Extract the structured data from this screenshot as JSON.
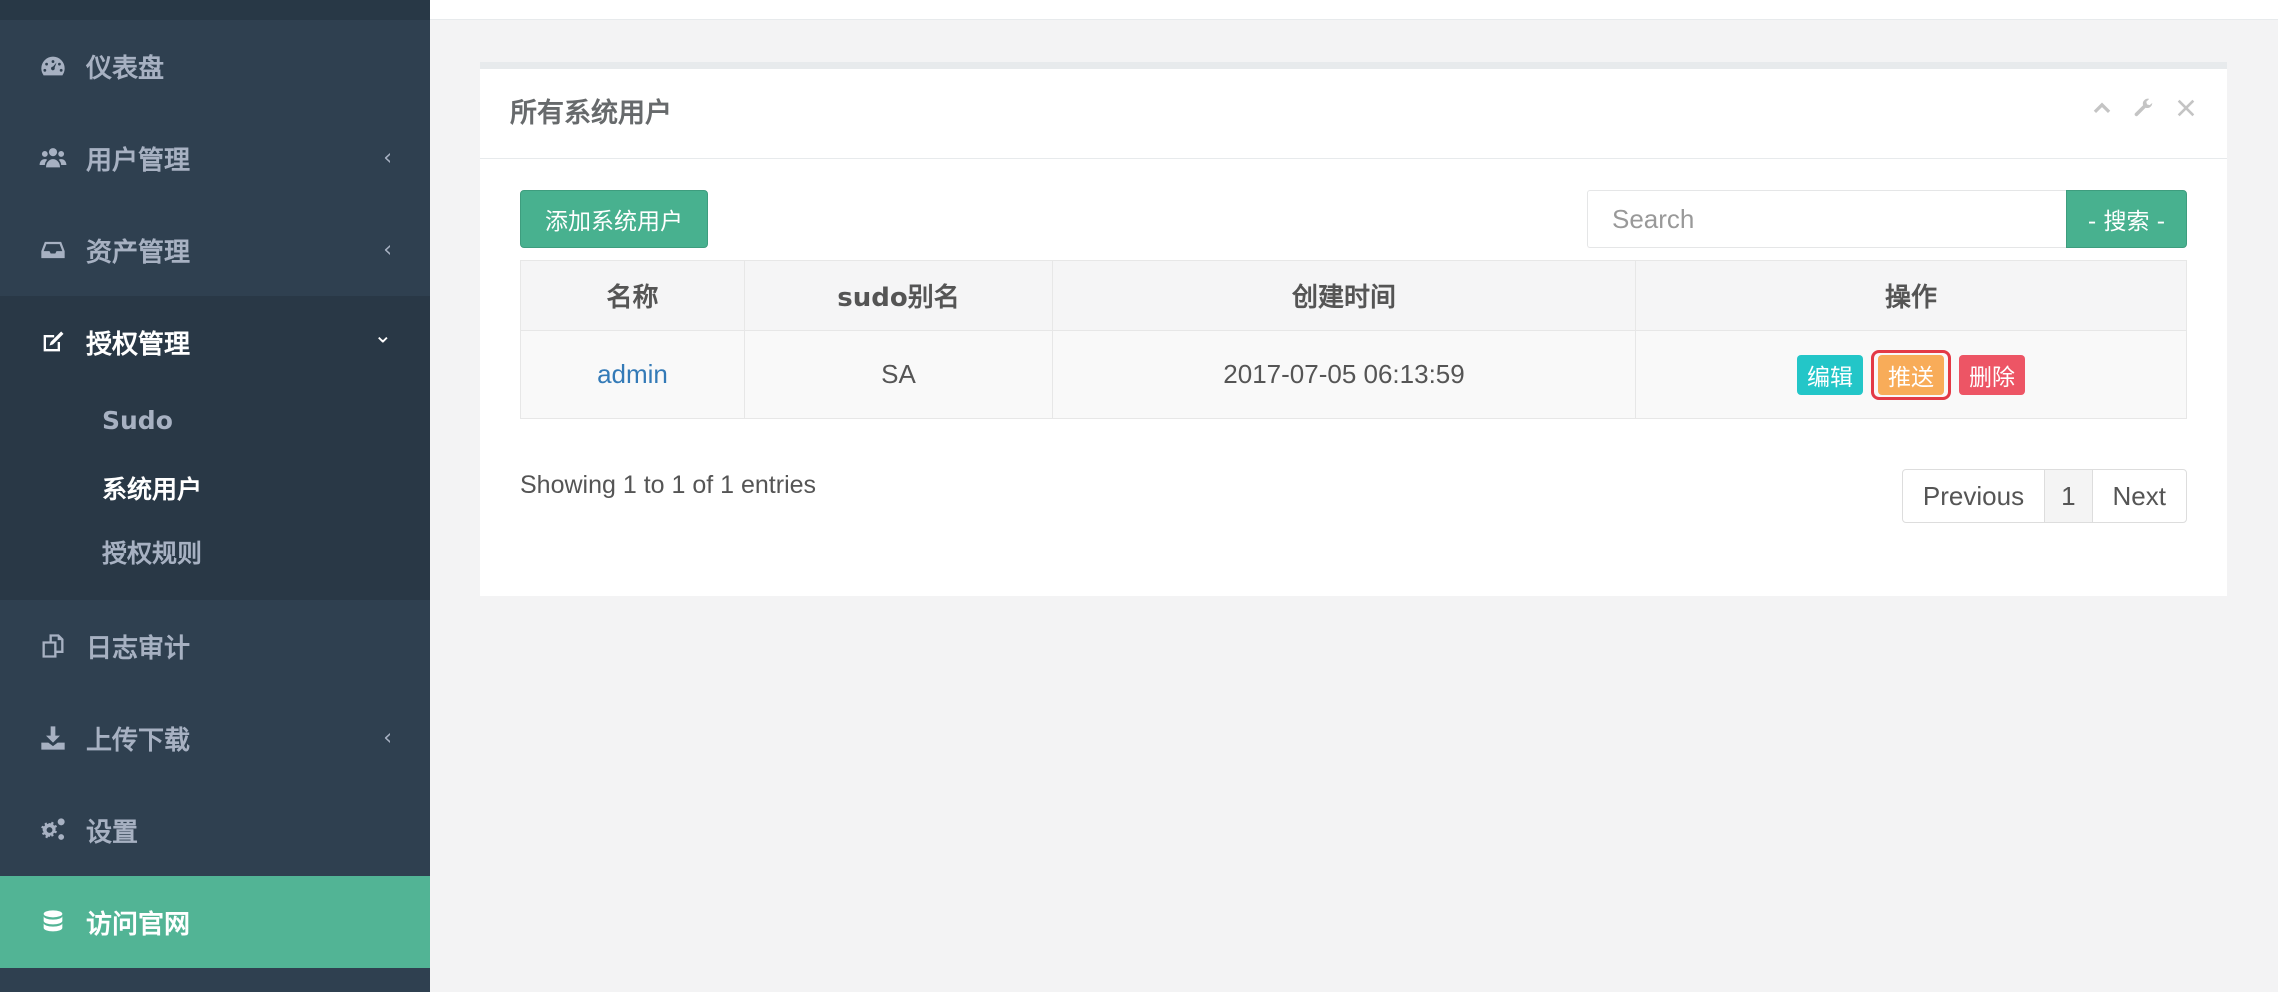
{
  "sidebar": {
    "items": [
      {
        "label": "仪表盘",
        "icon": "dashboard-icon"
      },
      {
        "label": "用户管理",
        "icon": "users-icon",
        "arrow": "‹"
      },
      {
        "label": "资产管理",
        "icon": "inbox-icon",
        "arrow": "‹"
      },
      {
        "label": "授权管理",
        "icon": "edit-icon",
        "arrow": "⌄"
      },
      {
        "label": "日志审计",
        "icon": "copy-icon"
      },
      {
        "label": "上传下载",
        "icon": "download-icon",
        "arrow": "‹"
      },
      {
        "label": "设置",
        "icon": "gears-icon"
      },
      {
        "label": "访问官网",
        "icon": "database-icon"
      }
    ],
    "subitems": [
      "Sudo",
      "系统用户",
      "授权规则"
    ]
  },
  "panel": {
    "title": "所有系统用户",
    "add_button": "添加系统用户",
    "search_placeholder": "Search",
    "search_button": "- 搜索 -"
  },
  "table": {
    "headers": [
      "名称",
      "sudo别名",
      "创建时间",
      "操作"
    ],
    "rows": [
      {
        "name": "admin",
        "sudo": "SA",
        "created": "2017-07-05 06:13:59"
      }
    ],
    "actions": {
      "edit": "编辑",
      "push": "推送",
      "delete": "删除"
    }
  },
  "footer": {
    "info": "Showing 1 to 1 of 1 entries",
    "prev": "Previous",
    "page": "1",
    "next": "Next"
  },
  "colors": {
    "sidebar_bg": "#2f4050",
    "accent": "#48b18f",
    "edit": "#23c6c8",
    "push": "#f8ac59",
    "delete": "#ed5565",
    "highlight_border": "#e33a46"
  }
}
